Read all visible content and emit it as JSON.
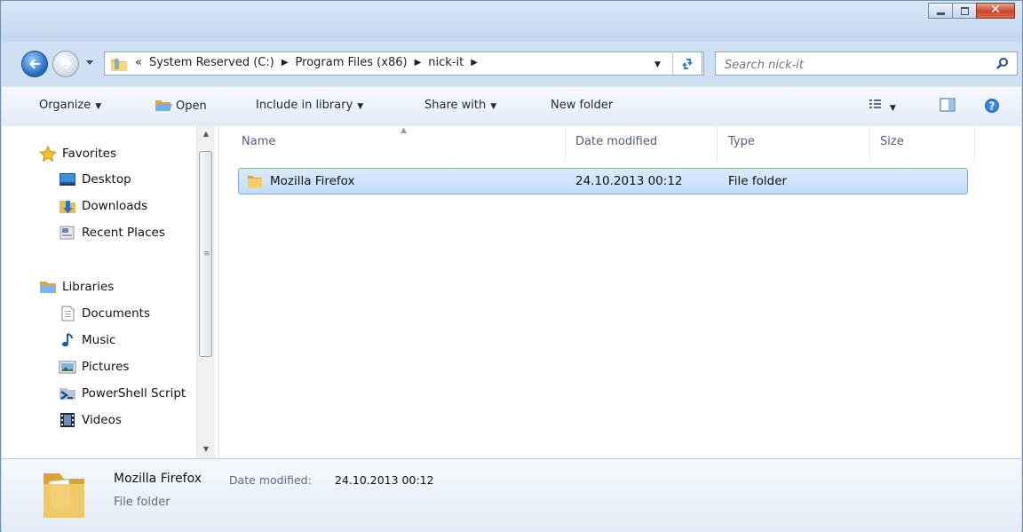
{
  "address": {
    "overflow": "«",
    "crumbs": [
      "System Reserved (C:)",
      "Program Files (x86)",
      "nick-it"
    ]
  },
  "search": {
    "placeholder": "Search nick-it"
  },
  "toolbar": {
    "organize": "Organize",
    "open": "Open",
    "include_in_library": "Include in library",
    "share_with": "Share with",
    "new_folder": "New folder"
  },
  "sidebar": {
    "favorites": "Favorites",
    "favorites_items": [
      "Desktop",
      "Downloads",
      "Recent Places"
    ],
    "libraries": "Libraries",
    "libraries_items": [
      "Documents",
      "Music",
      "Pictures",
      "PowerShell Script",
      "Videos"
    ]
  },
  "columns": {
    "name": "Name",
    "date_modified": "Date modified",
    "type": "Type",
    "size": "Size"
  },
  "files": [
    {
      "name": "Mozilla Firefox",
      "date_modified": "24.10.2013 00:12",
      "type": "File folder",
      "size": ""
    }
  ],
  "details": {
    "name": "Mozilla Firefox",
    "date_label": "Date modified:",
    "date_value": "24.10.2013 00:12",
    "type": "File folder"
  },
  "icons": {
    "back": "back-arrow-icon",
    "forward": "forward-arrow-icon",
    "search": "magnifier-icon",
    "refresh": "refresh-icon",
    "help": "help-icon"
  },
  "colors": {
    "window_frame": "#cfe0f3",
    "selection": "#c1dbfc",
    "accent": "#2a74c8"
  }
}
